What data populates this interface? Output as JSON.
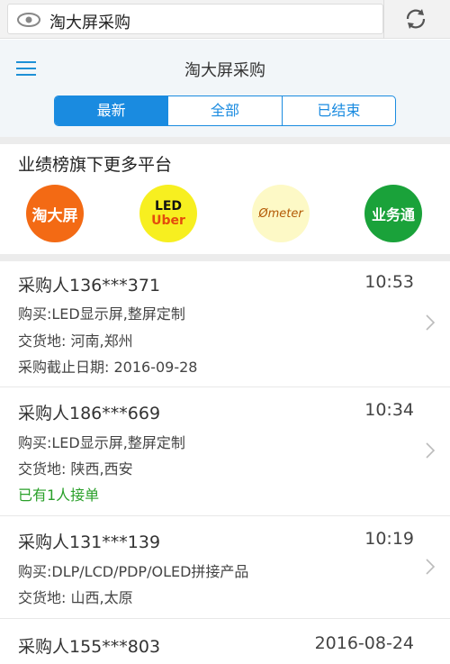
{
  "urlbar": {
    "text": "淘大屏采购"
  },
  "header": {
    "title": "淘大屏采购",
    "tabs": [
      {
        "label": "最新",
        "active": true
      },
      {
        "label": "全部",
        "active": false
      },
      {
        "label": "已结束",
        "active": false
      }
    ]
  },
  "platforms": {
    "title": "业绩榜旗下更多平台",
    "items": [
      {
        "name": "淘大屏"
      },
      {
        "name_top": "LED",
        "name_bottom": "Uber"
      },
      {
        "name": "meter"
      },
      {
        "name": "业务通"
      }
    ]
  },
  "orders": [
    {
      "buyer": "采购人136***371",
      "time": "10:53",
      "lines": [
        "购买:LED显示屏,整屏定制",
        "交货地: 河南,郑州",
        "采购截止日期: 2016-09-28"
      ]
    },
    {
      "buyer": "采购人186***669",
      "time": "10:34",
      "lines": [
        "购买:LED显示屏,整屏定制",
        "交货地: 陕西,西安"
      ],
      "status": "已有1人接单"
    },
    {
      "buyer": "采购人131***139",
      "time": "10:19",
      "lines": [
        "购买:DLP/LCD/PDP/OLED拼接产品",
        "交货地: 山西,太原"
      ]
    },
    {
      "buyer": "采购人155***803",
      "time": "2016-08-24",
      "lines": []
    }
  ],
  "colors": {
    "accent": "#1a8be0",
    "green": "#2aa02a"
  }
}
